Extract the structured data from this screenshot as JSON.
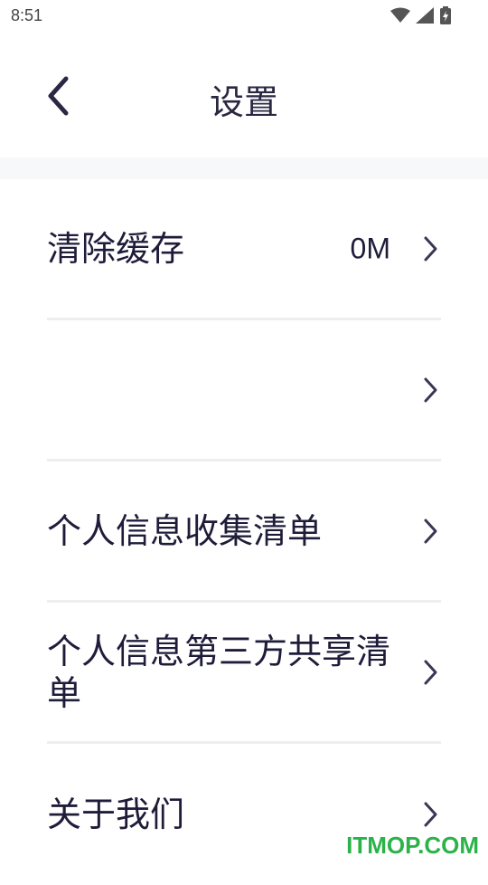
{
  "status": {
    "time": "8:51"
  },
  "header": {
    "title": "设置"
  },
  "settings": {
    "items": [
      {
        "label": "清除缓存",
        "value": "0M"
      },
      {
        "label": "",
        "value": ""
      },
      {
        "label": "个人信息收集清单",
        "value": ""
      },
      {
        "label": "个人信息第三方共享清单",
        "value": ""
      },
      {
        "label": "关于我们",
        "value": ""
      }
    ]
  },
  "watermark": "ITMOP.COM",
  "icons": {
    "status": [
      "wifi-icon",
      "signal-icon",
      "battery-charging-icon"
    ],
    "back": "chevron-left-icon",
    "row": "chevron-right-icon"
  }
}
